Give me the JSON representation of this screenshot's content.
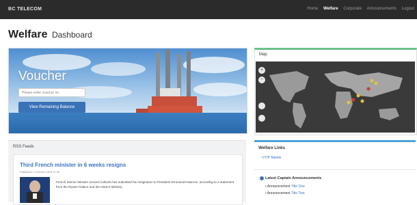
{
  "navbar": {
    "brand": "BC TELECOM",
    "links": [
      {
        "label": "Home",
        "active": false
      },
      {
        "label": "Welfare",
        "active": true
      },
      {
        "label": "Corporate",
        "active": false
      },
      {
        "label": "Announcements",
        "active": false
      },
      {
        "label": "Logout",
        "active": false
      }
    ]
  },
  "page": {
    "title": "Welfare",
    "subtitle": "Dashboard"
  },
  "voucher": {
    "heading": "Voucher",
    "input_placeholder": "Please enter voucher no.",
    "button_label": "View Remaining Balance"
  },
  "map": {
    "heading": "Map",
    "zoom_in": "+",
    "zoom_out": "−"
  },
  "rss": {
    "heading": "RSS Feeds",
    "article": {
      "title": "Third French minister in 6 weeks resigns",
      "meta": "Published: 1 October 2018 11:26",
      "body": "French Interior Minister Gerard Collomb has submitted his resignation to President Emmanuel Macron, according to a statement from the Elysee Palace and the Interior Ministry."
    }
  },
  "welfare_links": {
    "heading": "Welfare Links",
    "items": [
      "HTP Markle"
    ]
  },
  "announcements": {
    "heading": "Latest Captain Announcements",
    "items": [
      {
        "prefix": "Announcement",
        "link": "Title One"
      },
      {
        "prefix": "Announcement",
        "link": "Title Two"
      }
    ]
  },
  "colors": {
    "topbar": "#2b2b2b",
    "accent_blue": "#3d74bd",
    "map_border": "#6bbf8a",
    "links_border": "#4aa3d6"
  }
}
